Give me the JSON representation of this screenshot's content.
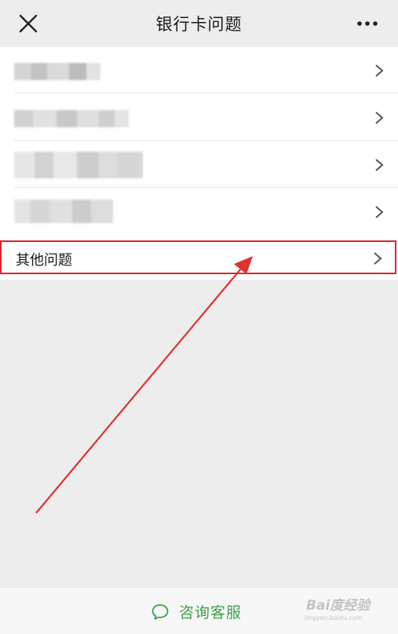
{
  "header": {
    "title": "银行卡问题",
    "close_icon": "close-icon",
    "more_icon": "more-icon"
  },
  "list": {
    "items": [
      {
        "label": "",
        "redacted": true
      },
      {
        "label": "",
        "redacted": true
      },
      {
        "label": "",
        "redacted": true
      },
      {
        "label": "",
        "redacted": true
      },
      {
        "label": "其他问题",
        "highlighted": true
      }
    ]
  },
  "footer": {
    "service_label": "咨询客服",
    "service_icon": "chat-bubble-icon"
  },
  "watermark": {
    "text": "Bai度经验",
    "sub": "jingyan.baidu.com"
  },
  "colors": {
    "background": "#ededed",
    "highlight": "#d9262b",
    "service": "#3aa24a"
  }
}
